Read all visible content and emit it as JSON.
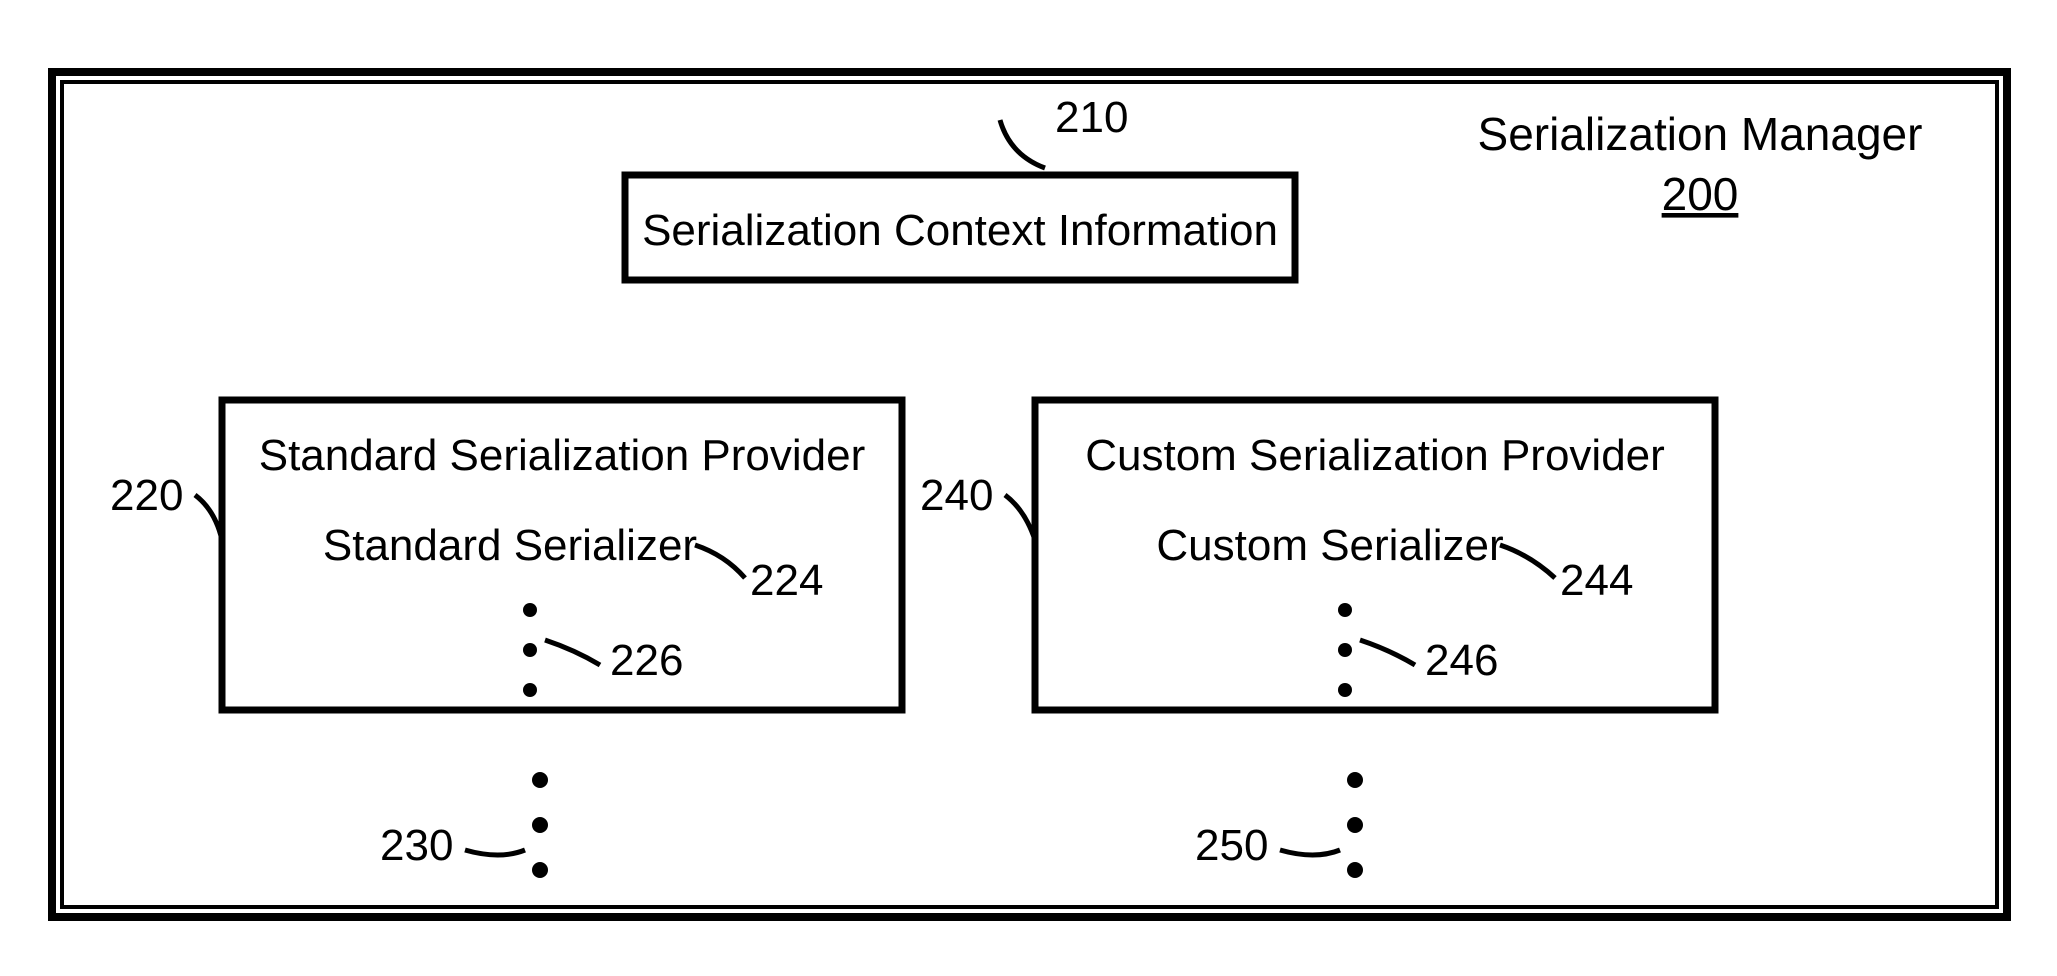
{
  "diagram": {
    "manager": {
      "title": "Serialization Manager",
      "ref": "200"
    },
    "context": {
      "label": "Serialization Context Information",
      "ref": "210"
    },
    "standard_provider": {
      "title": "Standard Serialization Provider",
      "serializer": "Standard Serializer",
      "ref_provider": "220",
      "ref_serializer": "224",
      "ref_dots_inner": "226",
      "ref_dots_outer": "230"
    },
    "custom_provider": {
      "title": "Custom Serialization Provider",
      "serializer": "Custom Serializer",
      "ref_provider": "240",
      "ref_serializer": "244",
      "ref_dots_inner": "246",
      "ref_dots_outer": "250"
    }
  }
}
